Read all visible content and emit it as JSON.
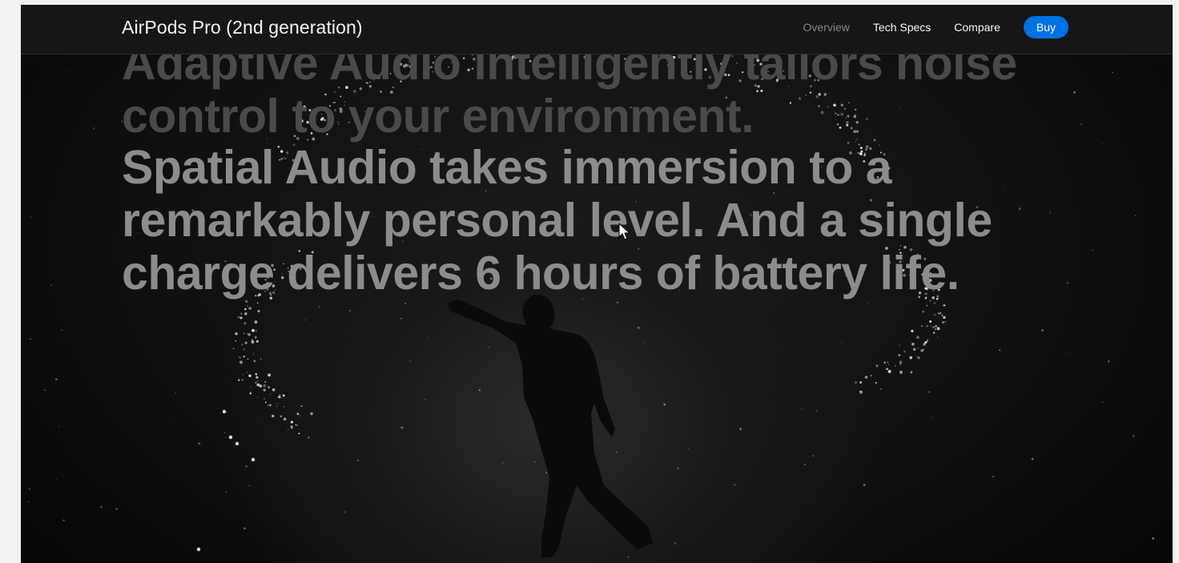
{
  "nav": {
    "product_title": "AirPods Pro (2nd generation)",
    "links": [
      {
        "label": "Overview",
        "current": true
      },
      {
        "label": "Tech Specs",
        "current": false
      },
      {
        "label": "Compare",
        "current": false
      }
    ],
    "buy_label": "Buy",
    "accent_color": "#0071e3"
  },
  "hero": {
    "faded_text": "Adaptive Audio intelligently tailors noise control to your environment.",
    "active_text": "Spatial Audio takes immersion to a remarkably personal level. And a single charge delivers 6 hours of battery life.",
    "background_image": "silhouette of a person dancing amid sparkling particles"
  },
  "icons": {
    "cursor": "arrow-pointer-icon"
  }
}
